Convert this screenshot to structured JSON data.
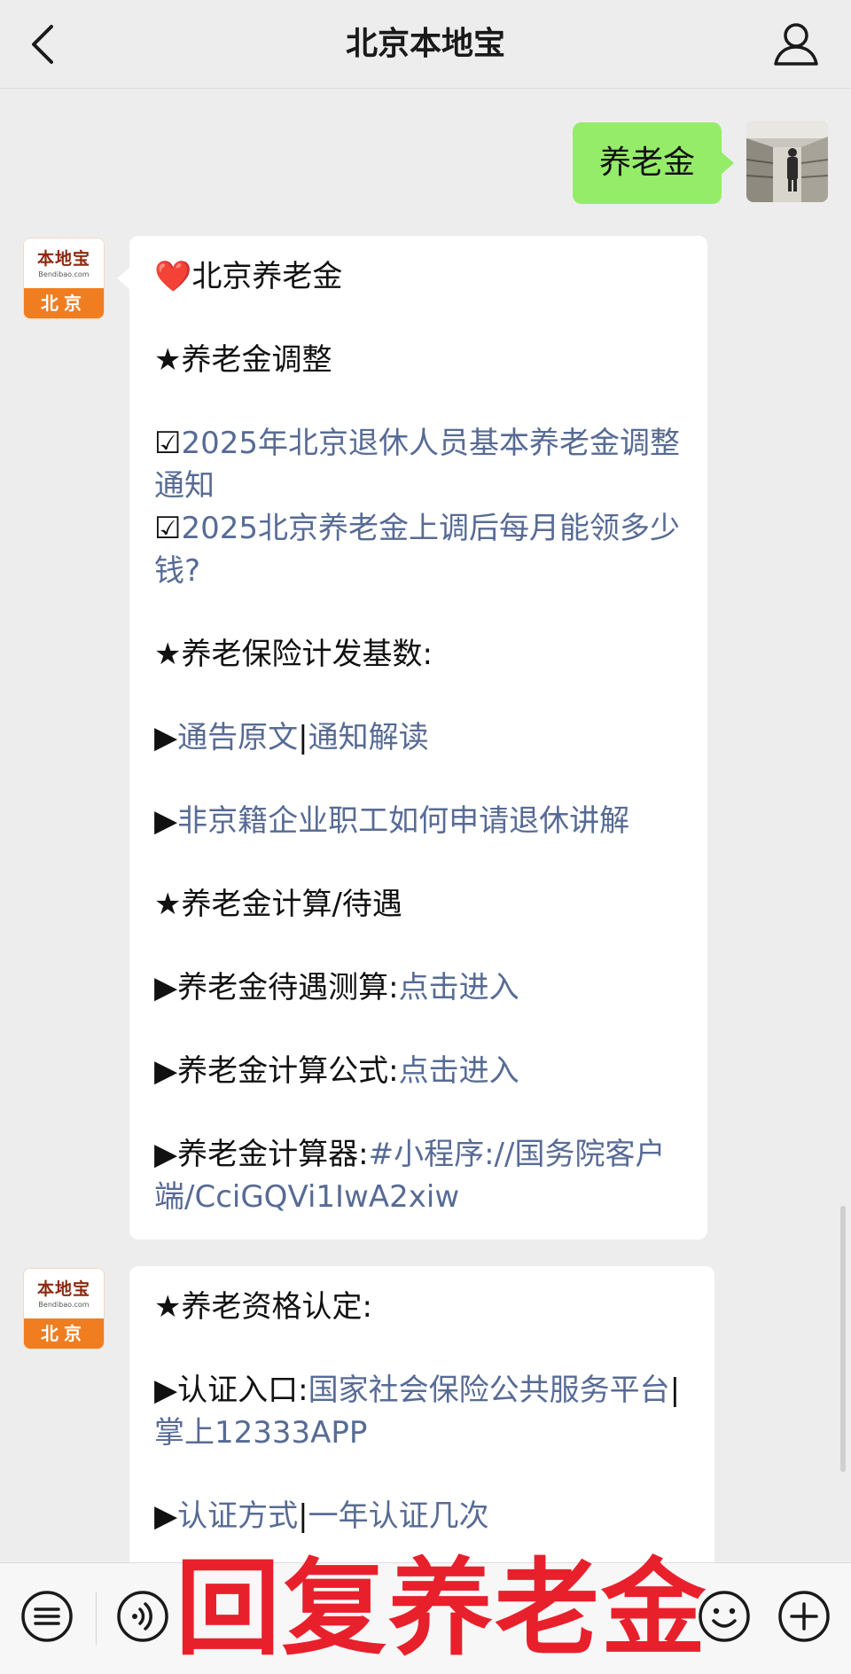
{
  "header": {
    "title": "北京本地宝",
    "back_icon": "chevron-left-icon",
    "profile_icon": "person-icon"
  },
  "user_message": {
    "text": "养老金"
  },
  "bot_avatar": {
    "logo_word": "本地宝",
    "logo_url": "Bendibao.com",
    "city": "北京"
  },
  "message1": {
    "title_icon": "❤️",
    "title": "北京养老金",
    "section1_heading": "★养老金调整",
    "item1_prefix": "☑",
    "item1_link": "2025年北京退休人员基本养老金调整通知",
    "item2_prefix": "☑",
    "item2_link": "2025北京养老金上调后每月能领多少钱?",
    "section2_heading": "★养老保险计发基数:",
    "row1_prefix": "▶",
    "row1_link_a": "通告原文",
    "row1_sep": "|",
    "row1_link_b": "通知解读",
    "row2_prefix": "▶",
    "row2_link": "非京籍企业职工如何申请退休讲解",
    "section3_heading": "★养老金计算/待遇",
    "row3_label": "▶养老金待遇测算:",
    "row3_link": "点击进入",
    "row4_label": "▶养老金计算公式:",
    "row4_link": "点击进入",
    "row5_label": "▶养老金计算器:",
    "row5_link": "#小程序://国务院客户端/CciGQVi1IwA2xiw"
  },
  "message2": {
    "section_heading": "★养老资格认定:",
    "row1_label": "▶认证入口:",
    "row1_link_a": "国家社会保险公共服务平台",
    "row1_sep": "|",
    "row1_link_b": "掌上12333APP",
    "row2_prefix": "▶",
    "row2_link_a": "认证方式",
    "row2_sep": "|",
    "row2_link_b": "一年认证几次"
  },
  "bottom_bar": {
    "menu_icon": "list-menu-icon",
    "voice_icon": "voice-icon",
    "emoji_icon": "smiley-icon",
    "plus_icon": "plus-icon"
  },
  "overlay": {
    "text": "回复养老金"
  },
  "colors": {
    "background": "#ededed",
    "user_bubble": "#95ec69",
    "link": "#576b95",
    "overlay_red": "#e8202c",
    "logo_orange": "#f07d1f"
  }
}
